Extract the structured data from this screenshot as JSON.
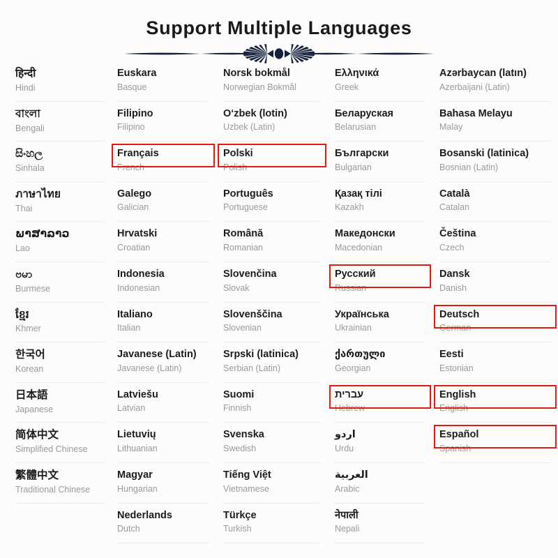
{
  "header": {
    "title": "Support Multiple Languages",
    "divider_icon": "ornamental-divider-icon",
    "divider_color": "#14213d"
  },
  "theme": {
    "background": "#fdfcfa",
    "native_text_color": "#1c1c1c",
    "english_text_color": "#9a9a9a",
    "separator_color": "#ececec",
    "highlight_color": "#e11b12"
  },
  "columns": [
    {
      "id": "column-1",
      "items": [
        {
          "native": "हिन्दी",
          "english": "Hindi",
          "highlighted": false
        },
        {
          "native": "বাংলা",
          "english": "Bengali",
          "highlighted": false
        },
        {
          "native": "සිංහල",
          "english": "Sinhala",
          "highlighted": false
        },
        {
          "native": "ภาษาไทย",
          "english": "Thai",
          "highlighted": false
        },
        {
          "native": "ພາສາລາວ",
          "english": "Lao",
          "highlighted": false
        },
        {
          "native": "ဗမာ",
          "english": "Burmese",
          "highlighted": false
        },
        {
          "native": "ខ្មែរ",
          "english": "Khmer",
          "highlighted": false
        },
        {
          "native": "한국어",
          "english": "Korean",
          "highlighted": false
        },
        {
          "native": "日本語",
          "english": "Japanese",
          "highlighted": false
        },
        {
          "native": "简体中文",
          "english": "Simplified Chinese",
          "highlighted": false
        },
        {
          "native": "繁體中文",
          "english": "Traditional Chinese",
          "highlighted": false
        }
      ]
    },
    {
      "id": "column-2",
      "items": [
        {
          "native": "Euskara",
          "english": "Basque",
          "highlighted": false
        },
        {
          "native": "Filipino",
          "english": "Filipino",
          "highlighted": false
        },
        {
          "native": "Français",
          "english": "French",
          "highlighted": true
        },
        {
          "native": "Galego",
          "english": "Galician",
          "highlighted": false
        },
        {
          "native": "Hrvatski",
          "english": "Croatian",
          "highlighted": false
        },
        {
          "native": "Indonesia",
          "english": "Indonesian",
          "highlighted": false
        },
        {
          "native": "Italiano",
          "english": "Italian",
          "highlighted": false
        },
        {
          "native": "Javanese (Latin)",
          "english": "Javanese (Latin)",
          "highlighted": false
        },
        {
          "native": "Latviešu",
          "english": "Latvian",
          "highlighted": false
        },
        {
          "native": "Lietuvių",
          "english": "Lithuanian",
          "highlighted": false
        },
        {
          "native": "Magyar",
          "english": "Hungarian",
          "highlighted": false
        },
        {
          "native": "Nederlands",
          "english": "Dutch",
          "highlighted": false
        }
      ]
    },
    {
      "id": "column-3",
      "items": [
        {
          "native": "Norsk bokmål",
          "english": "Norwegian Bokmål",
          "highlighted": false
        },
        {
          "native": "O‘zbek (lotin)",
          "english": "Uzbek (Latin)",
          "highlighted": false
        },
        {
          "native": "Polski",
          "english": "Polish",
          "highlighted": true
        },
        {
          "native": "Português",
          "english": "Portuguese",
          "highlighted": false
        },
        {
          "native": "Română",
          "english": "Romanian",
          "highlighted": false
        },
        {
          "native": "Slovenčina",
          "english": "Slovak",
          "highlighted": false
        },
        {
          "native": "Slovenščina",
          "english": "Slovenian",
          "highlighted": false
        },
        {
          "native": "Srpski (latinica)",
          "english": "Serbian (Latin)",
          "highlighted": false
        },
        {
          "native": "Suomi",
          "english": "Finnish",
          "highlighted": false
        },
        {
          "native": "Svenska",
          "english": "Swedish",
          "highlighted": false
        },
        {
          "native": "Tiếng Việt",
          "english": "Vietnamese",
          "highlighted": false
        },
        {
          "native": "Türkçe",
          "english": "Turkish",
          "highlighted": false
        }
      ]
    },
    {
      "id": "column-4",
      "items": [
        {
          "native": "Ελληνικά",
          "english": "Greek",
          "highlighted": false
        },
        {
          "native": "Беларуская",
          "english": "Belarusian",
          "highlighted": false
        },
        {
          "native": "Български",
          "english": "Bulgarian",
          "highlighted": false
        },
        {
          "native": "Қазақ тілі",
          "english": "Kazakh",
          "highlighted": false
        },
        {
          "native": "Македонски",
          "english": "Macedonian",
          "highlighted": false
        },
        {
          "native": "Русский",
          "english": "Russian",
          "highlighted": true
        },
        {
          "native": "Українська",
          "english": "Ukrainian",
          "highlighted": false
        },
        {
          "native": "ქართული",
          "english": "Georgian",
          "highlighted": false
        },
        {
          "native": "עברית",
          "english": "Hebrew",
          "highlighted": true
        },
        {
          "native": "اردو",
          "english": "Urdu",
          "highlighted": false
        },
        {
          "native": "العربية",
          "english": "Arabic",
          "highlighted": false
        },
        {
          "native": "नेपाली",
          "english": "Nepali",
          "highlighted": false
        }
      ]
    },
    {
      "id": "column-5",
      "items": [
        {
          "native": "Azərbaycan (latın)",
          "english": "Azerbaijani (Latin)",
          "highlighted": false
        },
        {
          "native": "Bahasa Melayu",
          "english": "Malay",
          "highlighted": false
        },
        {
          "native": "Bosanski (latinica)",
          "english": "Bosnian (Latin)",
          "highlighted": false
        },
        {
          "native": "Català",
          "english": "Catalan",
          "highlighted": false
        },
        {
          "native": "Čeština",
          "english": "Czech",
          "highlighted": false
        },
        {
          "native": "Dansk",
          "english": "Danish",
          "highlighted": false
        },
        {
          "native": "Deutsch",
          "english": "German",
          "highlighted": true
        },
        {
          "native": "Eesti",
          "english": "Estonian",
          "highlighted": false
        },
        {
          "native": "English",
          "english": "English",
          "highlighted": true
        },
        {
          "native": "Español",
          "english": "Spanish",
          "highlighted": true
        }
      ]
    }
  ]
}
